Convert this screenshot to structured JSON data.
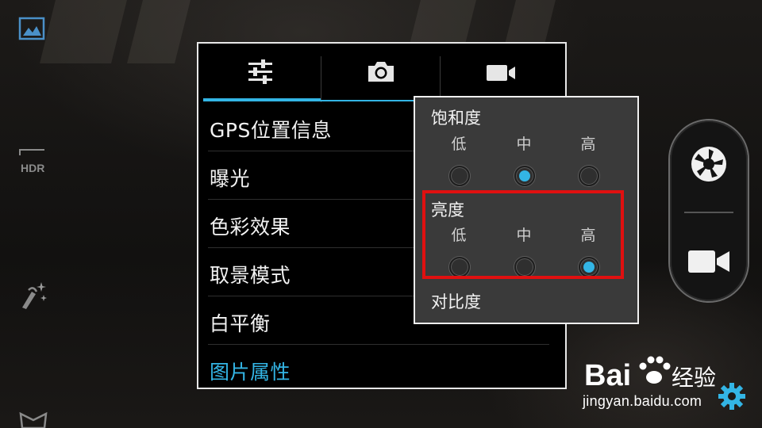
{
  "settings_panel": {
    "tabs": [
      {
        "name": "sliders-icon",
        "active": true
      },
      {
        "name": "camera-icon",
        "active": false
      },
      {
        "name": "video-camera-icon",
        "active": false
      }
    ],
    "rows": [
      {
        "label": "GPS位置信息"
      },
      {
        "label": "曝光"
      },
      {
        "label": "色彩效果"
      },
      {
        "label": "取景模式"
      },
      {
        "label": "白平衡"
      },
      {
        "label": "图片属性"
      }
    ]
  },
  "image_properties_popup": {
    "saturation": {
      "title": "饱和度",
      "options": [
        "低",
        "中",
        "高"
      ],
      "selected": "中"
    },
    "brightness": {
      "title": "亮度",
      "options": [
        "低",
        "中",
        "高"
      ],
      "selected": "高"
    },
    "contrast": {
      "title": "对比度"
    }
  },
  "left_rail": {
    "icons": [
      "gallery-icon",
      "hdr-icon",
      "magic-wand-icon",
      "mask-icon"
    ],
    "hdr_label": "HDR"
  },
  "shutter_control": {
    "icons": [
      "shutter-icon",
      "video-camera-icon"
    ]
  },
  "watermark": {
    "logo_text": "Bai",
    "logo_suffix": "经验",
    "url": "jingyan.baidu.com"
  },
  "colors": {
    "accent": "#33b5e5",
    "highlight_box": "#e01010",
    "popup_bg": "#3a3a3a"
  }
}
